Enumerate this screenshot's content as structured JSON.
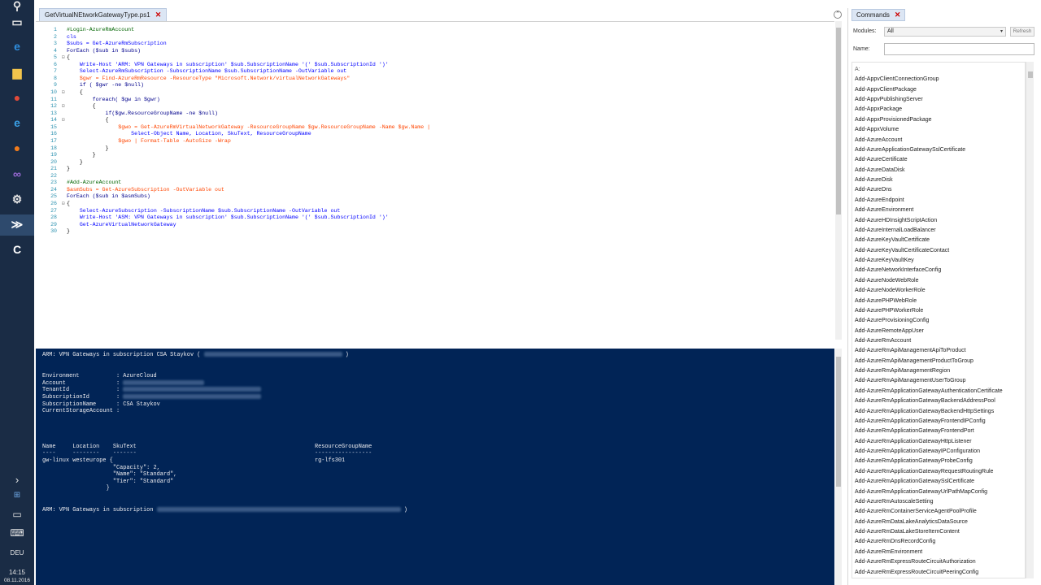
{
  "editor": {
    "tab_label": "GetVirtualNEtworkGatewayType.ps1",
    "tab_close": "✕",
    "minimize_glyph": "⌃"
  },
  "code_lines": [
    {
      "n": "1",
      "t": "#Login-AzureRmAccount",
      "c": "#006400"
    },
    {
      "n": "2",
      "t": "cls",
      "c": "#0000ff"
    },
    {
      "n": "3",
      "t": "$subs = Get-AzureRmSubscription",
      "c": "#0000ff"
    },
    {
      "n": "4",
      "t": "ForEach ($sub in $subs)",
      "c": "#00008b"
    },
    {
      "n": "5",
      "t": "{",
      "c": "#000000"
    },
    {
      "n": "6",
      "t": "    Write-Host 'ARM: VPN Gateways in subscription' $sub.SubscriptionName '(' $sub.SubscriptionId ')'",
      "c": "#0000ff"
    },
    {
      "n": "7",
      "t": "    Select-AzureRmSubscription -SubscriptionName $sub.SubscriptionName -OutVariable out",
      "c": "#0000ff"
    },
    {
      "n": "8",
      "t": "    $gwr = Find-AzureRmResource -ResourceType \"Microsoft.Network/virtualNetworkGateways\"",
      "c": "#ff4500"
    },
    {
      "n": "9",
      "t": "    if ( $gwr -ne $null)",
      "c": "#00008b"
    },
    {
      "n": "10",
      "t": "    {",
      "c": "#000000"
    },
    {
      "n": "11",
      "t": "        foreach( $gw in $gwr)",
      "c": "#00008b"
    },
    {
      "n": "12",
      "t": "        {",
      "c": "#000000"
    },
    {
      "n": "13",
      "t": "            if($gw.ResourceGroupName -ne $null)",
      "c": "#00008b"
    },
    {
      "n": "14",
      "t": "            {",
      "c": "#000000"
    },
    {
      "n": "15",
      "t": "                $gwo = Get-AzureRmVirtualNetworkGateway -ResourceGroupName $gw.ResourceGroupName -Name $gw.Name |",
      "c": "#ff4500"
    },
    {
      "n": "16",
      "t": "                    Select-Object Name, Location, SkuText, ResourceGroupName",
      "c": "#0000ff"
    },
    {
      "n": "17",
      "t": "                $gwo | Format-Table -AutoSize -Wrap",
      "c": "#ff4500"
    },
    {
      "n": "18",
      "t": "            }",
      "c": "#000000"
    },
    {
      "n": "19",
      "t": "        }",
      "c": "#000000"
    },
    {
      "n": "20",
      "t": "    }",
      "c": "#000000"
    },
    {
      "n": "21",
      "t": "}",
      "c": "#000000"
    },
    {
      "n": "22",
      "t": "",
      "c": "#000000"
    },
    {
      "n": "23",
      "t": "#Add-AzureAccount",
      "c": "#006400"
    },
    {
      "n": "24",
      "t": "$asmSubs = Get-AzureSubscription -OutVariable out",
      "c": "#ff4500"
    },
    {
      "n": "25",
      "t": "ForEach ($sub in $asmSubs)",
      "c": "#00008b"
    },
    {
      "n": "26",
      "t": "{",
      "c": "#000000"
    },
    {
      "n": "27",
      "t": "    Select-AzureSubscription -SubscriptionName $sub.SubscriptionName -OutVariable out",
      "c": "#0000ff"
    },
    {
      "n": "28",
      "t": "    Write-Host 'ASM: VPN Gateways in subscription' $sub.SubscriptionName '(' $sub.SubscriptionId ')'",
      "c": "#0000ff"
    },
    {
      "n": "29",
      "t": "    Get-AzureVirtualNetworkGateway",
      "c": "#0000ff"
    },
    {
      "n": "30",
      "t": "}",
      "c": "#000000"
    }
  ],
  "console": {
    "header_line": "ARM: VPN Gateways in subscription CSA Staykov (",
    "header_close": ")",
    "env_rows": [
      {
        "k": "Environment           ",
        "v": ": AzureCloud",
        "blur": false
      },
      {
        "k": "Account               ",
        "v": ": ",
        "blur": true
      },
      {
        "k": "TenantId              ",
        "v": ": ",
        "blur": true
      },
      {
        "k": "SubscriptionId        ",
        "v": ": ",
        "blur": true
      },
      {
        "k": "SubscriptionName      ",
        "v": ": CSA Staykov",
        "blur": false
      },
      {
        "k": "CurrentStorageAccount ",
        "v": ":",
        "blur": false
      }
    ],
    "table_header": "Name     Location    SkuText                                                     ResourceGroupName",
    "table_rule": "----     --------    -------                                                     -----------------",
    "table_row": "gw-linux westeurope {                                                            rg-lfs301",
    "sku_lines": [
      "                     \"Capacity\": 2,",
      "                     \"Name\": \"Standard\",",
      "                     \"Tier\": \"Standard\"",
      "                   }"
    ],
    "footer_line": "ARM: VPN Gateways in subscription ",
    "footer_close": ")"
  },
  "commands": {
    "tab_label": "Commands",
    "tab_close": "✕",
    "modules_label": "Modules:",
    "modules_value": "All",
    "refresh_label": "Refresh",
    "name_label": "Name:",
    "list": [
      "A:",
      "Add-AppvClientConnectionGroup",
      "Add-AppvClientPackage",
      "Add-AppvPublishingServer",
      "Add-AppxPackage",
      "Add-AppxProvisionedPackage",
      "Add-AppxVolume",
      "Add-AzureAccount",
      "Add-AzureApplicationGatewaySslCertificate",
      "Add-AzureCertificate",
      "Add-AzureDataDisk",
      "Add-AzureDisk",
      "Add-AzureDns",
      "Add-AzureEndpoint",
      "Add-AzureEnvironment",
      "Add-AzureHDInsightScriptAction",
      "Add-AzureInternalLoadBalancer",
      "Add-AzureKeyVaultCertificate",
      "Add-AzureKeyVaultCertificateContact",
      "Add-AzureKeyVaultKey",
      "Add-AzureNetworkInterfaceConfig",
      "Add-AzureNodeWebRole",
      "Add-AzureNodeWorkerRole",
      "Add-AzurePHPWebRole",
      "Add-AzurePHPWorkerRole",
      "Add-AzureProvisioningConfig",
      "Add-AzureRemoteAppUser",
      "Add-AzureRmAccount",
      "Add-AzureRmApiManagementApiToProduct",
      "Add-AzureRmApiManagementProductToGroup",
      "Add-AzureRmApiManagementRegion",
      "Add-AzureRmApiManagementUserToGroup",
      "Add-AzureRmApplicationGatewayAuthenticationCertificate",
      "Add-AzureRmApplicationGatewayBackendAddressPool",
      "Add-AzureRmApplicationGatewayBackendHttpSettings",
      "Add-AzureRmApplicationGatewayFrontendIPConfig",
      "Add-AzureRmApplicationGatewayFrontendPort",
      "Add-AzureRmApplicationGatewayHttpListener",
      "Add-AzureRmApplicationGatewayIPConfiguration",
      "Add-AzureRmApplicationGatewayProbeConfig",
      "Add-AzureRmApplicationGatewayRequestRoutingRule",
      "Add-AzureRmApplicationGatewaySslCertificate",
      "Add-AzureRmApplicationGatewayUrlPathMapConfig",
      "Add-AzureRmAutoscaleSetting",
      "Add-AzureRmContainerServiceAgentPoolProfile",
      "Add-AzureRmDataLakeAnalyticsDataSource",
      "Add-AzureRmDataLakeStoreItemContent",
      "Add-AzureRmDnsRecordConfig",
      "Add-AzureRmEnvironment",
      "Add-AzureRmExpressRouteCircuitAuthorization",
      "Add-AzureRmExpressRouteCircuitPeeringConfig"
    ]
  },
  "taskbar": {
    "icons": [
      {
        "name": "search-icon",
        "glyph": "⚲",
        "color": "#e6e6e6"
      },
      {
        "name": "task-view-icon",
        "glyph": "▭",
        "color": "#e6e6e6"
      },
      {
        "name": "edge-icon",
        "glyph": "e",
        "color": "#2f8fe0"
      },
      {
        "name": "file-explorer-icon",
        "glyph": "▆",
        "color": "#f2c44c"
      },
      {
        "name": "chrome-icon",
        "glyph": "●",
        "color": "#e04a3a"
      },
      {
        "name": "ie-icon",
        "glyph": "e",
        "color": "#3aa0e6"
      },
      {
        "name": "firefox-icon",
        "glyph": "●",
        "color": "#f07b1c"
      },
      {
        "name": "visual-studio-icon",
        "glyph": "∞",
        "color": "#9a6ad6"
      },
      {
        "name": "network-app-icon",
        "glyph": "⚙",
        "color": "#e6e6e6"
      },
      {
        "name": "powershell-ise-icon",
        "glyph": "≫",
        "color": "#ffffff"
      },
      {
        "name": "camtasia-icon",
        "glyph": "C",
        "color": "#ffffff"
      }
    ],
    "tray_chevron": "›",
    "tray_app": "⊞",
    "keyboard_glyph": "⌨",
    "language": "DEU",
    "time": "14:15",
    "date": "08.11.2016"
  }
}
